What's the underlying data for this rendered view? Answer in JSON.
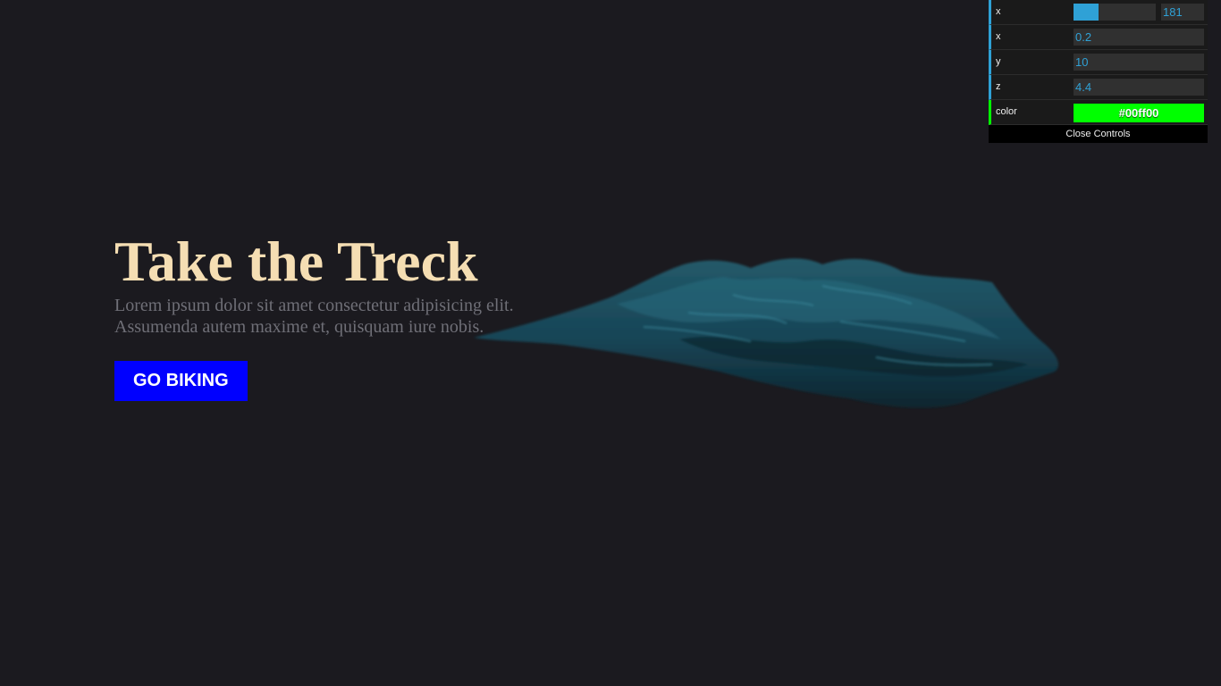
{
  "hero": {
    "title": "Take the Treck",
    "text_line1": "Lorem ipsum dolor sit amet consectetur adipisicing elit.",
    "text_line2": "Assumenda autem maxime et, quisquam iure nobis.",
    "button_label": "GO BIKING"
  },
  "colors": {
    "background": "#1b1a1f",
    "title": "#f5deb3",
    "body_text": "#6f6f77",
    "button": "#0000ff",
    "terrain": "#1c5566",
    "gui_accent": "#2fa1d6"
  },
  "controls": {
    "rows": [
      {
        "label": "x",
        "value": "181",
        "slider_fraction": 0.3
      },
      {
        "label": "x",
        "value": "0.2"
      },
      {
        "label": "y",
        "value": "10"
      },
      {
        "label": "z",
        "value": "4.4"
      },
      {
        "label": "color",
        "value": "#00ff00"
      }
    ],
    "close_label": "Close Controls"
  }
}
